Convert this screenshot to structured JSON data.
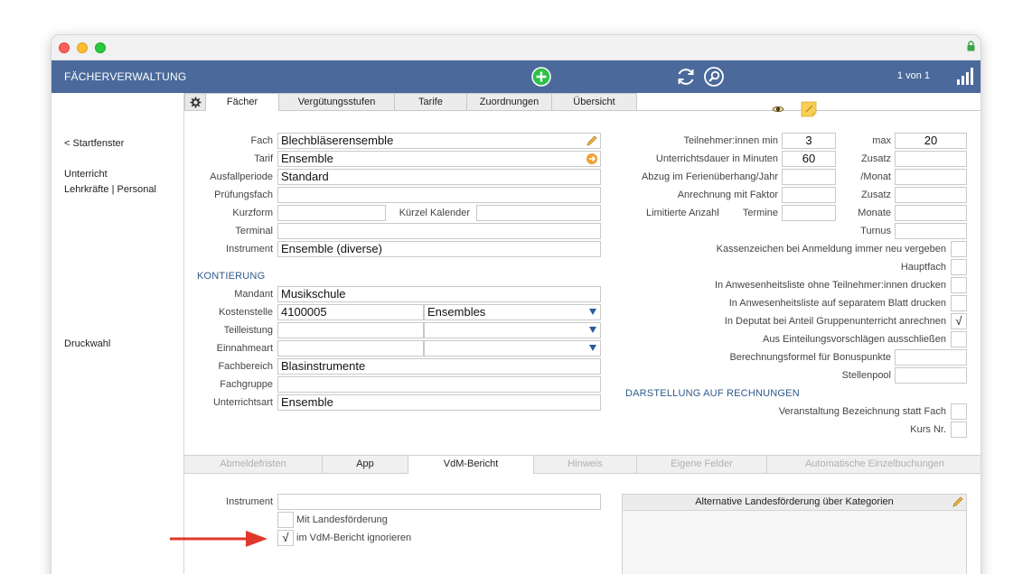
{
  "window": {
    "title": "FÄCHERVERWALTUNG",
    "pager": "1 von 1"
  },
  "sidebar": {
    "back": "< Startfenster",
    "item1": "Unterricht",
    "item2": "Lehrkräfte | Personal",
    "item3": "Druckwahl"
  },
  "tabs": [
    "Fächer",
    "Vergütungsstufen",
    "Tarife",
    "Zuordnungen",
    "Übersicht"
  ],
  "left_form": {
    "fach_label": "Fach",
    "fach_value": "Blechbläserensemble",
    "tarif_label": "Tarif",
    "tarif_value": "Ensemble",
    "ausfall_label": "Ausfallperiode",
    "ausfall_value": "Standard",
    "pruef_label": "Prüfungsfach",
    "pruef_value": "",
    "kurzform_label": "Kurzform",
    "kurzform_value": "",
    "kuerzel_label": "Kürzel Kalender",
    "kuerzel_value": "",
    "terminal_label": "Terminal",
    "terminal_value": "",
    "instrument_label": "Instrument",
    "instrument_value": "Ensemble (diverse)"
  },
  "kontierung": {
    "heading": "KONTIERUNG",
    "mandant_label": "Mandant",
    "mandant_value": "Musikschule",
    "kosten_label": "Kostenstelle",
    "kosten_value": "4100005",
    "kosten_select": "Ensembles",
    "teil_label": "Teilleistung",
    "teil_value": "",
    "teil_select": "",
    "einnahme_label": "Einnahmeart",
    "einnahme_value": "",
    "einnahme_select": "",
    "fachbereich_label": "Fachbereich",
    "fachbereich_value": "Blasinstrumente",
    "fachgruppe_label": "Fachgruppe",
    "fachgruppe_value": "",
    "uart_label": "Unterrichtsart",
    "uart_value": "Ensemble"
  },
  "right_form": {
    "tn_min_label": "Teilnehmer:innen min",
    "tn_min_value": "3",
    "max_label": "max",
    "max_value": "20",
    "dauer_label": "Unterrichtsdauer in Minuten",
    "dauer_value": "60",
    "zusatz1_label": "Zusatz",
    "zusatz1_value": "",
    "abzug_label": "Abzug im Ferienüberhang/Jahr",
    "abzug_value": "",
    "monat_label": "/Monat",
    "monat_value": "",
    "anrech_label": "Anrechnung mit Faktor",
    "anrech_value": "",
    "zusatz2_label": "Zusatz",
    "zusatz2_value": "",
    "limit_label": "Limitierte Anzahl",
    "termine_label": "Termine",
    "termine_value": "",
    "monate_label": "Monate",
    "monate_value": "",
    "turnus_label": "Turnus",
    "turnus_value": "",
    "kassen_label": "Kassenzeichen bei Anmeldung immer neu vergeben",
    "haupt_label": "Hauptfach",
    "anw1_label": "In Anwesenheitsliste ohne Teilnehmer:innen drucken",
    "anw2_label": "In Anwesenheitsliste auf separatem Blatt drucken",
    "deputat_label": "In Deputat bei Anteil Gruppenunterricht anrechnen",
    "deputat_check": "√",
    "einteil_label": "Aus Einteilungsvorschlägen ausschließen",
    "formel_label": "Berechnungsformel für Bonuspunkte",
    "formel_value": "",
    "stellen_label": "Stellenpool",
    "stellen_value": ""
  },
  "darstellung": {
    "heading": "DARSTELLUNG AUF RECHNUNGEN",
    "veranst_label": "Veranstaltung Bezeichnung statt Fach",
    "kurs_label": "Kurs Nr."
  },
  "bottom_tabs": [
    "Abmeldefristen",
    "App",
    "VdM-Bericht",
    "Hinweis",
    "Eigene Felder",
    "Automatische Einzelbuchungen"
  ],
  "vdm": {
    "instrument_label": "Instrument",
    "instrument_value": "",
    "landes_label": "Mit Landesförderung",
    "ignore_label": "im VdM-Bericht ignorieren",
    "ignore_check": "√",
    "alt_heading": "Alternative Landesförderung über Kategorien"
  },
  "colors": {
    "toolbar": "#4b6a9b",
    "section": "#2e5a8c",
    "add_green": "#2fbf4a",
    "tarif_orange": "#f0a030",
    "arrow_red": "#e0382b"
  }
}
